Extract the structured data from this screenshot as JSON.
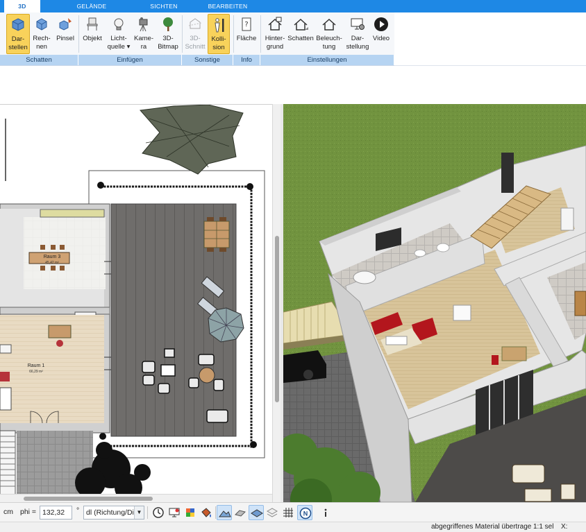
{
  "tabs": [
    {
      "label": "3D",
      "active": true
    },
    {
      "label": "GELÄNDE",
      "active": false
    },
    {
      "label": "SICHTEN",
      "active": false
    },
    {
      "label": "BEARBEITEN",
      "active": false
    }
  ],
  "ribbon": {
    "groups": [
      {
        "label": "Schatten"
      },
      {
        "label": "Einfügen"
      },
      {
        "label": "Sonstige"
      },
      {
        "label": "Info"
      },
      {
        "label": "Einstellungen"
      }
    ],
    "buttons": [
      {
        "line1": "Dar-",
        "line2": "stellen",
        "icon": "cube-render-icon",
        "active": true,
        "disabled": false
      },
      {
        "line1": "Rech-",
        "line2": "nen",
        "icon": "cube-compute-icon",
        "active": false,
        "disabled": false
      },
      {
        "line1": "Pinsel",
        "line2": "",
        "icon": "cube-brush-icon",
        "active": false,
        "disabled": false
      },
      {
        "line1": "Objekt",
        "line2": "",
        "icon": "chair-icon",
        "active": false,
        "disabled": false
      },
      {
        "line1": "Licht-",
        "line2": "quelle",
        "icon": "lightbulb-icon",
        "active": false,
        "disabled": false
      },
      {
        "line1": "Kame-",
        "line2": "ra",
        "icon": "camera-icon",
        "active": false,
        "disabled": false
      },
      {
        "line1": "3D-",
        "line2": "Bitmap",
        "icon": "tree-icon",
        "active": false,
        "disabled": false
      },
      {
        "line1": "3D-",
        "line2": "Schnitt",
        "icon": "section-cut-icon",
        "active": false,
        "disabled": true
      },
      {
        "line1": "Kolli-",
        "line2": "sion",
        "icon": "person-collision-icon",
        "active": true,
        "disabled": false
      },
      {
        "line1": "Fläche",
        "line2": "",
        "icon": "area-info-icon",
        "active": false,
        "disabled": false
      },
      {
        "line1": "Hinter-",
        "line2": "grund",
        "icon": "house-background-icon",
        "active": false,
        "disabled": false
      },
      {
        "line1": "Schatten",
        "line2": "",
        "icon": "house-shadow-icon",
        "active": false,
        "disabled": false
      },
      {
        "line1": "Beleuch-",
        "line2": "tung",
        "icon": "house-light-icon",
        "active": false,
        "disabled": false
      },
      {
        "line1": "Dar-",
        "line2": "stellung",
        "icon": "monitor-settings-icon",
        "active": false,
        "disabled": false
      },
      {
        "line1": "Video",
        "line2": "",
        "icon": "video-play-icon",
        "active": false,
        "disabled": false
      }
    ]
  },
  "plan": {
    "rooms": [
      {
        "name": "Raum 3",
        "area": "45,42 m²"
      },
      {
        "name": "Raum 1",
        "area": "66,29 m²"
      }
    ]
  },
  "toolbar": {
    "unit": "cm",
    "phi_label": "phi =",
    "phi_value": "132,32",
    "degree": "°",
    "dl_select": "dl (Richtung/Di",
    "compass": "N"
  },
  "status": {
    "message": "abgegriffenes Material übertrage",
    "scale": "1:1 sel",
    "x_label": "X:"
  },
  "colors": {
    "tab_bar": "#1e88e5",
    "group_label_bg": "#b6d4f2",
    "active_button": "#f8d25b",
    "lawn": "#6f9140"
  }
}
